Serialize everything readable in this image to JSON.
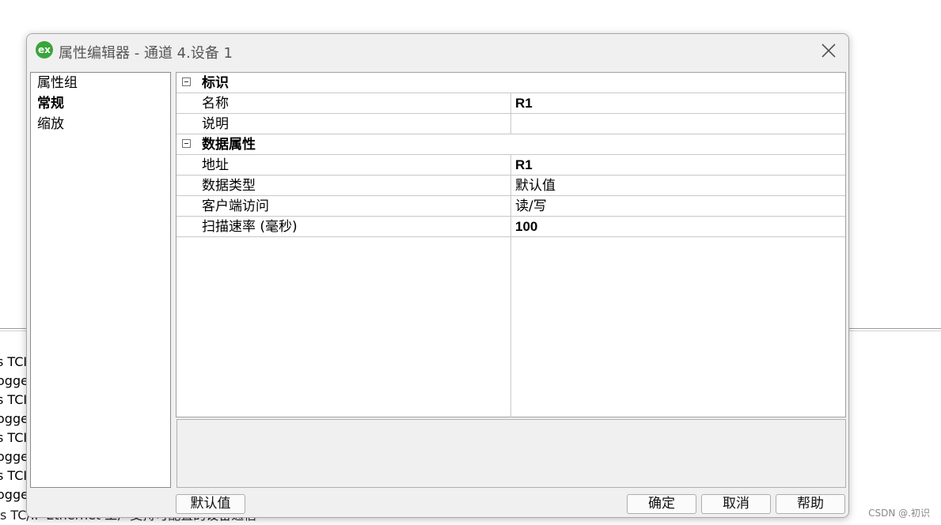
{
  "background": {
    "log_lines": [
      "s TCI",
      "ogger",
      "s TCI",
      "ogger",
      "s TCI",
      "ogger",
      "s TCI",
      "ogger"
    ],
    "bottom_line": "s TC/IP Ethernet 工厂支持可配置的设备通信",
    "watermark": "CSDN @.初识"
  },
  "dialog": {
    "title": "属性编辑器 - 通道 4.设备 1",
    "icon_text": "ex",
    "icon_color": "#3aa53a"
  },
  "property_groups": {
    "header": "属性组",
    "items": [
      "常规",
      "缩放"
    ],
    "selected": "常规"
  },
  "grid": {
    "categories": [
      {
        "label": "标识",
        "properties": [
          {
            "name": "名称",
            "value": "R1"
          },
          {
            "name": "说明",
            "value": ""
          }
        ]
      },
      {
        "label": "数据属性",
        "properties": [
          {
            "name": "地址",
            "value": "R1"
          },
          {
            "name": "数据类型",
            "value": "默认值"
          },
          {
            "name": "客户端访问",
            "value": "读/写"
          },
          {
            "name": "扫描速率 (毫秒)",
            "value": "100"
          }
        ]
      }
    ]
  },
  "buttons": {
    "defaults": "默认值",
    "ok": "确定",
    "cancel": "取消",
    "help": "帮助"
  }
}
